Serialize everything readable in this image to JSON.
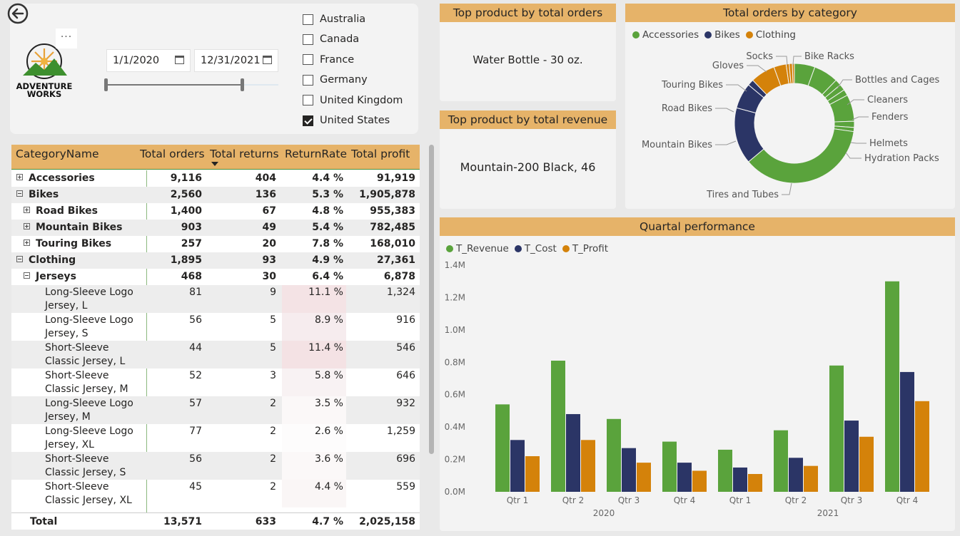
{
  "filters": {
    "start_date": "1/1/2020",
    "end_date": "12/31/2021",
    "more_label": "···",
    "logo_text_1": "ADVENTURE",
    "logo_text_2": "WORKS",
    "countries": [
      {
        "name": "Australia",
        "checked": false
      },
      {
        "name": "Canada",
        "checked": false
      },
      {
        "name": "France",
        "checked": false
      },
      {
        "name": "Germany",
        "checked": false
      },
      {
        "name": "United Kingdom",
        "checked": false
      },
      {
        "name": "United States",
        "checked": true
      }
    ]
  },
  "matrix": {
    "columns": [
      "CategoryName",
      "Total orders",
      "Total returns",
      "ReturnRate",
      "Total profit"
    ],
    "rows": [
      {
        "label": "Accessories",
        "orders": "9,116",
        "returns": "404",
        "rate": "4.4 %",
        "profit": "91,919",
        "level": 0,
        "bold": true,
        "expander": "plus"
      },
      {
        "label": "Bikes",
        "orders": "2,560",
        "returns": "136",
        "rate": "5.3 %",
        "profit": "1,905,878",
        "level": 0,
        "bold": true,
        "expander": "minus"
      },
      {
        "label": "Road Bikes",
        "orders": "1,400",
        "returns": "67",
        "rate": "4.8 %",
        "profit": "955,383",
        "level": 1,
        "bold": true,
        "expander": "plus"
      },
      {
        "label": "Mountain Bikes",
        "orders": "903",
        "returns": "49",
        "rate": "5.4 %",
        "profit": "782,485",
        "level": 1,
        "bold": true,
        "expander": "plus"
      },
      {
        "label": "Touring Bikes",
        "orders": "257",
        "returns": "20",
        "rate": "7.8 %",
        "profit": "168,010",
        "level": 1,
        "bold": true,
        "expander": "plus"
      },
      {
        "label": "Clothing",
        "orders": "1,895",
        "returns": "93",
        "rate": "4.9 %",
        "profit": "27,361",
        "level": 0,
        "bold": true,
        "expander": "minus"
      },
      {
        "label": "Jerseys",
        "orders": "468",
        "returns": "30",
        "rate": "6.4 %",
        "profit": "6,878",
        "level": 1,
        "bold": true,
        "expander": "minus"
      },
      {
        "label1": "Long-Sleeve Logo",
        "label2": "Jersey, L",
        "orders": "81",
        "returns": "9",
        "rate": "11.1 %",
        "profit": "1,324",
        "level": 2,
        "heat": "#f4e3e5"
      },
      {
        "label1": "Long-Sleeve Logo",
        "label2": "Jersey, S",
        "orders": "56",
        "returns": "5",
        "rate": "8.9 %",
        "profit": "916",
        "level": 2,
        "heat": "#f6ecee"
      },
      {
        "label1": "Short-Sleeve",
        "label2": "Classic Jersey, L",
        "orders": "44",
        "returns": "5",
        "rate": "11.4 %",
        "profit": "546",
        "level": 2,
        "heat": "#f4e2e4"
      },
      {
        "label1": "Short-Sleeve",
        "label2": "Classic Jersey, M",
        "orders": "52",
        "returns": "3",
        "rate": "5.8 %",
        "profit": "646",
        "level": 2,
        "heat": "#f8f2f3"
      },
      {
        "label1": "Long-Sleeve Logo",
        "label2": "Jersey, M",
        "orders": "57",
        "returns": "2",
        "rate": "3.5 %",
        "profit": "932",
        "level": 2,
        "heat": "#fbf8f8"
      },
      {
        "label1": "Long-Sleeve Logo",
        "label2": "Jersey, XL",
        "orders": "77",
        "returns": "2",
        "rate": "2.6 %",
        "profit": "1,259",
        "level": 2,
        "heat": "#fdfcfc"
      },
      {
        "label1": "Short-Sleeve",
        "label2": "Classic Jersey, S",
        "orders": "56",
        "returns": "2",
        "rate": "3.6 %",
        "profit": "696",
        "level": 2,
        "heat": "#fbf8f8"
      },
      {
        "label1": "Short-Sleeve",
        "label2": "Classic Jersey, XL",
        "orders": "45",
        "returns": "2",
        "rate": "4.4 %",
        "profit": "559",
        "level": 2,
        "heat": "#faf6f6"
      }
    ],
    "total": {
      "label": "Total",
      "orders": "13,571",
      "returns": "633",
      "rate": "4.7 %",
      "profit": "2,025,158"
    }
  },
  "cards": {
    "top_orders_title": "Top product by total orders",
    "top_orders_value": "Water Bottle - 30 oz.",
    "top_revenue_title": "Top product by total revenue",
    "top_revenue_value": "Mountain-200 Black, 46"
  },
  "donut": {
    "title": "Total orders by category",
    "legend": [
      {
        "name": "Accessories",
        "color": "#5aa33c"
      },
      {
        "name": "Bikes",
        "color": "#2b3566"
      },
      {
        "name": "Clothing",
        "color": "#d4820a"
      }
    ],
    "labels": [
      "Socks",
      "Bike Racks",
      "Gloves",
      "Bottles and Cages",
      "Touring Bikes",
      "Cleaners",
      "Road Bikes",
      "Fenders",
      "Mountain Bikes",
      "Helmets",
      "Hydration Packs",
      "Tires and Tubes"
    ]
  },
  "chart_data": {
    "type": "bar",
    "title": "Quartal performance",
    "categories": [
      "Qtr 1",
      "Qtr 2",
      "Qtr 3",
      "Qtr 4",
      "Qtr 1",
      "Qtr 2",
      "Qtr 3",
      "Qtr 4"
    ],
    "groups": [
      "2020",
      "2021"
    ],
    "series": [
      {
        "name": "T_Revenue",
        "color": "#5aa33c",
        "values": [
          0.54,
          0.81,
          0.45,
          0.31,
          0.26,
          0.38,
          0.78,
          1.3
        ]
      },
      {
        "name": "T_Cost",
        "color": "#2b3566",
        "values": [
          0.32,
          0.48,
          0.27,
          0.18,
          0.15,
          0.21,
          0.44,
          0.74
        ]
      },
      {
        "name": "T_Profit",
        "color": "#d4820a",
        "values": [
          0.22,
          0.32,
          0.18,
          0.13,
          0.11,
          0.16,
          0.34,
          0.56
        ]
      }
    ],
    "y_ticks": [
      "0.0M",
      "0.2M",
      "0.4M",
      "0.6M",
      "0.8M",
      "1.0M",
      "1.2M",
      "1.4M"
    ],
    "ylim": [
      0,
      1.4
    ],
    "ylabel": "",
    "xlabel": ""
  }
}
